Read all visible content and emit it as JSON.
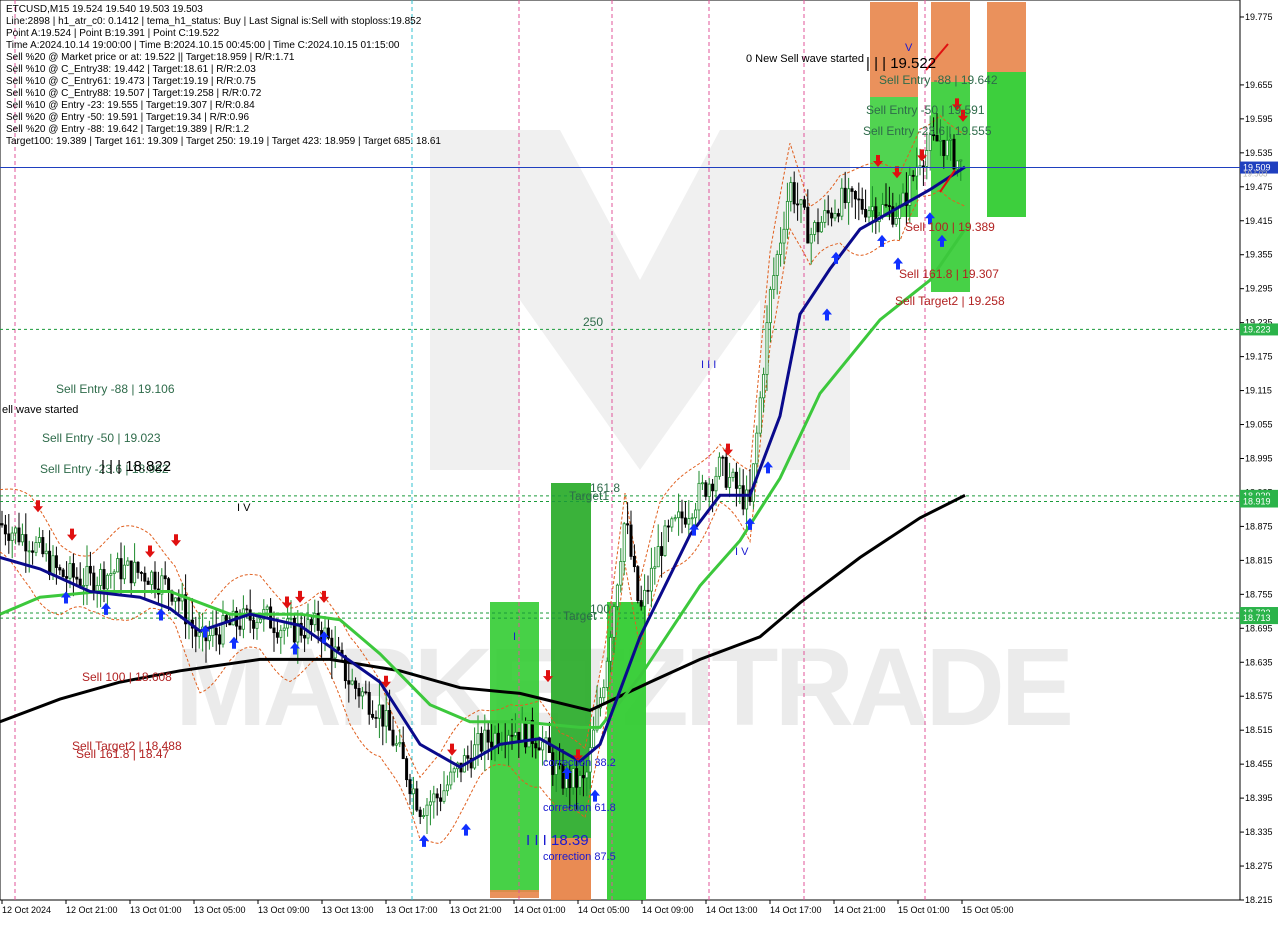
{
  "info_panel": [
    "ETCUSD,M15  19.524 19.540 19.503 19.503",
    "Line:2898 | h1_atr_c0: 0.1412 | tema_h1_status: Buy | Last Signal is:Sell with stoploss:19.852",
    "Point A:19.524 | Point B:19.391 | Point C:19.522",
    "Time A:2024.10.14 19:00:00 | Time B:2024.10.15 00:45:00 | Time C:2024.10.15 01:15:00",
    "Sell %20 @ Market price or at: 19.522 || Target:18.959 | R/R:1.71",
    "Sell %10 @ C_Entry38: 19.442 | Target:18.61 | R/R:2.03",
    "Sell %10 @ C_Entry61: 19.473 | Target:19.19 | R/R:0.75",
    "Sell %10 @ C_Entry88: 19.507 | Target:19.258 | R/R:0.72",
    "Sell %10 @ Entry -23: 19.555 | Target:19.307 | R/R:0.84",
    "Sell %20 @ Entry -50: 19.591 | Target:19.34 | R/R:0.96",
    "Sell %20 @ Entry -88: 19.642 | Target:19.389 | R/R:1.2",
    "Target100: 19.389 | Target 161: 19.309 | Target 250: 19.19 | Target 423: 18.959 | Target 685: 18.61"
  ],
  "price_axis": {
    "ticks": [
      "19.775",
      "19.655",
      "19.595",
      "19.535",
      "19.475",
      "19.415",
      "19.355",
      "19.295",
      "19.235",
      "19.175",
      "19.115",
      "19.055",
      "18.995",
      "18.935",
      "18.875",
      "18.815",
      "18.755",
      "18.695",
      "18.635",
      "18.575",
      "18.515",
      "18.455",
      "18.395",
      "18.335",
      "18.275",
      "18.215"
    ],
    "current_price": "19.509",
    "current_price_hidden": "19.503",
    "badges": [
      {
        "label": "19.223",
        "color": "#2bb34a"
      },
      {
        "label": "18.929",
        "color": "#2bb34a"
      },
      {
        "label": "18.919",
        "color": "#2bb34a"
      },
      {
        "label": "18.722",
        "color": "#2bb34a"
      },
      {
        "label": "18.713",
        "color": "#2bb34a"
      }
    ]
  },
  "time_axis": [
    "12 Oct 2024",
    "12 Oct 21:00",
    "13 Oct 01:00",
    "13 Oct 05:00",
    "13 Oct 09:00",
    "13 Oct 13:00",
    "13 Oct 17:00",
    "13 Oct 21:00",
    "14 Oct 01:00",
    "14 Oct 05:00",
    "14 Oct 09:00",
    "14 Oct 13:00",
    "14 Oct 17:00",
    "14 Oct 21:00",
    "15 Oct 01:00",
    "15 Oct 05:00"
  ],
  "annotations": {
    "new_sell_wave": "0 New Sell wave started",
    "wave_label_top": "| | | 19.522",
    "sell_entry_88_top": "Sell Entry -88 | 19.642",
    "sell_entry_50_top": "Sell Entry -50 | 19.591",
    "sell_entry_23_top": "Sell Entry -23.6 | 19.555",
    "sell_100_top": "Sell 100 | 19.389",
    "sell_161_top": "Sell 161.8 | 19.307",
    "sell_target2_top": "Sell Target2 | 19.258",
    "label_250": "250",
    "wave_iii": "I I I",
    "wave_v_top": "V",
    "wave_iv_mid": "I V",
    "sell_entry_88_left": "Sell Entry -88 | 19.106",
    "sell_wave_started_left": "ell wave started",
    "sell_entry_50_left": "Sell Entry -50 | 19.023",
    "sell_entry_23_left": "Sell Entry -23.6 | 18.982",
    "wave_18822": "| | | 18.822",
    "wave_iv_left": "I V",
    "target1": "Target1",
    "target1_num": "161.8",
    "target_100": "Target",
    "target_100_num": "100",
    "sell_100_left": "Sell 100 | 18.608",
    "sell_target2_left": "Sell Target2 | 18.488",
    "sell_161_left": "Sell 161.8 | 18.47",
    "wave_i": "I",
    "correction_382": "correction 38.2",
    "correction_618": "correction 61.8",
    "correction_875": "correction 87.5",
    "wave_1839": "I I I 18.39",
    "watermark": "MARKETZITRADE"
  },
  "colors": {
    "bull_candle": "#1b8a2a",
    "bear_candle": "#000000",
    "ma_blue": "#0a0a8c",
    "ma_green": "#3cc83c",
    "ma_black": "#000000",
    "band_orange": "#e06020",
    "green_zone": "#33cc33",
    "orange_zone": "#e8854a",
    "current_price_line": "#1f3fbf",
    "dotted_green": "#1a9a3a"
  },
  "chart_data": {
    "type": "candlestick",
    "symbol": "ETCUSD",
    "timeframe": "M15",
    "ylim": [
      18.215,
      19.805
    ],
    "current_price": 19.509,
    "horizontal_levels": [
      19.223,
      18.929,
      18.919,
      18.722,
      18.713
    ],
    "moving_averages": {
      "blue": [
        [
          0,
          18.82
        ],
        [
          40,
          18.8
        ],
        [
          90,
          18.76
        ],
        [
          140,
          18.75
        ],
        [
          170,
          18.73
        ],
        [
          200,
          18.69
        ],
        [
          250,
          18.72
        ],
        [
          300,
          18.7
        ],
        [
          340,
          18.65
        ],
        [
          380,
          18.6
        ],
        [
          420,
          18.49
        ],
        [
          460,
          18.45
        ],
        [
          500,
          18.49
        ],
        [
          540,
          18.5
        ],
        [
          580,
          18.46
        ],
        [
          600,
          18.49
        ],
        [
          640,
          18.68
        ],
        [
          690,
          18.86
        ],
        [
          720,
          18.93
        ],
        [
          750,
          18.93
        ],
        [
          780,
          19.07
        ],
        [
          800,
          19.25
        ],
        [
          830,
          19.33
        ],
        [
          860,
          19.4
        ],
        [
          900,
          19.44
        ],
        [
          930,
          19.47
        ],
        [
          965,
          19.51
        ]
      ],
      "green": [
        [
          0,
          18.72
        ],
        [
          40,
          18.75
        ],
        [
          100,
          18.76
        ],
        [
          170,
          18.76
        ],
        [
          230,
          18.72
        ],
        [
          300,
          18.72
        ],
        [
          340,
          18.71
        ],
        [
          380,
          18.65
        ],
        [
          430,
          18.56
        ],
        [
          470,
          18.53
        ],
        [
          520,
          18.53
        ],
        [
          580,
          18.52
        ],
        [
          600,
          18.52
        ],
        [
          640,
          18.61
        ],
        [
          700,
          18.77
        ],
        [
          740,
          18.85
        ],
        [
          780,
          18.96
        ],
        [
          820,
          19.11
        ],
        [
          880,
          19.24
        ],
        [
          930,
          19.31
        ],
        [
          965,
          19.4
        ]
      ],
      "black": [
        [
          0,
          18.53
        ],
        [
          60,
          18.57
        ],
        [
          120,
          18.6
        ],
        [
          180,
          18.62
        ],
        [
          260,
          18.64
        ],
        [
          330,
          18.64
        ],
        [
          400,
          18.62
        ],
        [
          460,
          18.59
        ],
        [
          520,
          18.58
        ],
        [
          590,
          18.55
        ],
        [
          650,
          18.6
        ],
        [
          700,
          18.64
        ],
        [
          760,
          18.68
        ],
        [
          800,
          18.74
        ],
        [
          860,
          18.82
        ],
        [
          920,
          18.89
        ],
        [
          965,
          18.93
        ]
      ]
    },
    "ohlc_path": [
      [
        0,
        18.88
      ],
      [
        30,
        18.85
      ],
      [
        60,
        18.79
      ],
      [
        90,
        18.78
      ],
      [
        120,
        18.8
      ],
      [
        150,
        18.79
      ],
      [
        175,
        18.76
      ],
      [
        200,
        18.67
      ],
      [
        230,
        18.7
      ],
      [
        260,
        18.72
      ],
      [
        290,
        18.69
      ],
      [
        320,
        18.7
      ],
      [
        350,
        18.6
      ],
      [
        380,
        18.55
      ],
      [
        400,
        18.47
      ],
      [
        420,
        18.38
      ],
      [
        440,
        18.4
      ],
      [
        460,
        18.45
      ],
      [
        480,
        18.49
      ],
      [
        510,
        18.52
      ],
      [
        540,
        18.5
      ],
      [
        560,
        18.43
      ],
      [
        585,
        18.42
      ],
      [
        605,
        18.62
      ],
      [
        625,
        18.89
      ],
      [
        640,
        18.72
      ],
      [
        660,
        18.84
      ],
      [
        690,
        18.91
      ],
      [
        720,
        18.98
      ],
      [
        750,
        18.91
      ],
      [
        770,
        19.28
      ],
      [
        790,
        19.48
      ],
      [
        810,
        19.39
      ],
      [
        840,
        19.45
      ],
      [
        870,
        19.44
      ],
      [
        900,
        19.43
      ],
      [
        920,
        19.53
      ],
      [
        940,
        19.56
      ],
      [
        965,
        19.503
      ]
    ]
  }
}
